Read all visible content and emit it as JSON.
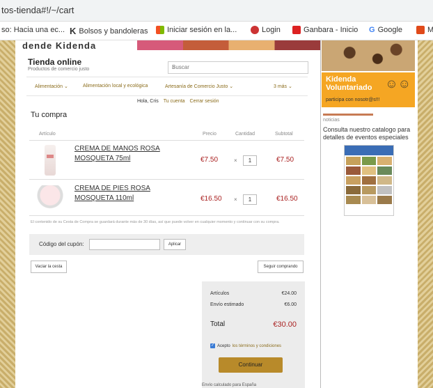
{
  "browser": {
    "url": "tos-tienda#!/~/cart",
    "bookmarks": [
      "so: Hacia una ec...",
      "Bolsos y bandoleras",
      "Iniciar sesión en la...",
      "Login",
      "Ganbara - Inicio",
      "Google",
      "M"
    ]
  },
  "header": {
    "store_title": "Tienda online",
    "store_subtitle": "Productos de comercio justo",
    "search_placeholder": "Buscar"
  },
  "nav": [
    "Alimentación ⌄",
    "Alimentación local y ecológica",
    "Artesanía de Comercio Justo ⌄",
    "3 más ⌄"
  ],
  "user": {
    "greeting": "Hola, Cris",
    "account": "Tu cuenta",
    "logout": "Cerrar sesión"
  },
  "cart": {
    "title": "Tu compra",
    "columns": {
      "article": "Artículo",
      "price": "Precio",
      "qty": "Cantidad",
      "subtotal": "Subtotal"
    },
    "items": [
      {
        "name": "CREMA DE MANOS ROSA MOSQUETA 75ml",
        "price": "€7.50",
        "qty_x": "×",
        "qty": "1",
        "subtotal": "€7.50"
      },
      {
        "name": "CREMA DE PIES ROSA MOSQUETA 110ml",
        "price": "€16.50",
        "qty_x": "×",
        "qty": "1",
        "subtotal": "€16.50"
      }
    ],
    "note": "El contenido de su Cesta de Compra se guardará durante más de 30 días, así que puede volver en cualquier momento y continuar con su compra.",
    "coupon_label": "Código del cupón:",
    "apply": "Aplicar",
    "empty": "Vaciar la cesta",
    "continue_shopping": "Seguir comprando"
  },
  "summary": {
    "articles_label": "Artículos",
    "articles_value": "€24.00",
    "shipping_label": "Envío estimado",
    "shipping_value": "€6.00",
    "total_label": "Total",
    "total_value": "€30.00",
    "accept_prefix": "Acepto ",
    "accept_link": "los términos y condiciones",
    "checkout": "Continuar",
    "footer_cut": "Envío calculado para España"
  },
  "sidebar": {
    "volunteer_title": "Kidenda Voluntariado",
    "volunteer_sub": "participa con nosotr@s!!!",
    "news_label": "noticias",
    "news_text": "Consulta nuestro catalogo para detalles de eventos especiales"
  },
  "colors": {
    "price_red": "#aa2222",
    "accent_gold": "#b88a2a",
    "volunteer_orange": "#f5a623",
    "link_gold": "#8a6b1a"
  }
}
